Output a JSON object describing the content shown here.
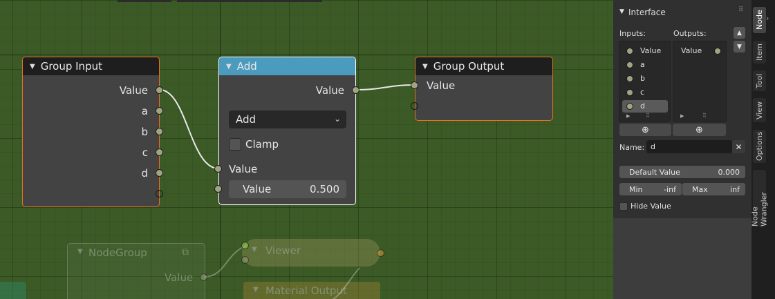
{
  "canvas": {
    "group_input": {
      "title": "Group Input",
      "outputs": [
        "Value",
        "a",
        "b",
        "c",
        "d"
      ]
    },
    "add_node": {
      "title": "Add",
      "output": "Value",
      "operation": "Add",
      "clamp_label": "Clamp",
      "input1_label": "Value",
      "input2_label": "Value",
      "input2_value": "0.500"
    },
    "group_output": {
      "title": "Group Output",
      "input": "Value"
    },
    "background_nodes": {
      "nodegroup_title": "NodeGroup",
      "nodegroup_output": "Value",
      "viewer_title": "Viewer",
      "material_output_title": "Material Output"
    }
  },
  "sidebar": {
    "panel_title": "Interface",
    "inputs_label": "Inputs:",
    "outputs_label": "Outputs:",
    "inputs": [
      "Value",
      "a",
      "b",
      "c",
      "d"
    ],
    "selected_input": "d",
    "outputs": [
      "Value"
    ],
    "name_label": "Name:",
    "name_value": "d",
    "default_value_label": "Default Value",
    "default_value": "0.000",
    "min_label": "Min",
    "min_value": "-inf",
    "max_label": "Max",
    "max_value": "inf",
    "hide_value_label": "Hide Value",
    "tabs": [
      "Node",
      "Item",
      "Tool",
      "View",
      "Options",
      "Node Wrangler"
    ],
    "active_tab": "Node"
  },
  "colors": {
    "canvas_bg": "#3b5a26",
    "node_body": "#434343",
    "node_header_dark": "#1e1e1e",
    "math_header": "#4b9bbf",
    "selection_orange": "#e8701e",
    "socket_float": "#a0a384"
  }
}
